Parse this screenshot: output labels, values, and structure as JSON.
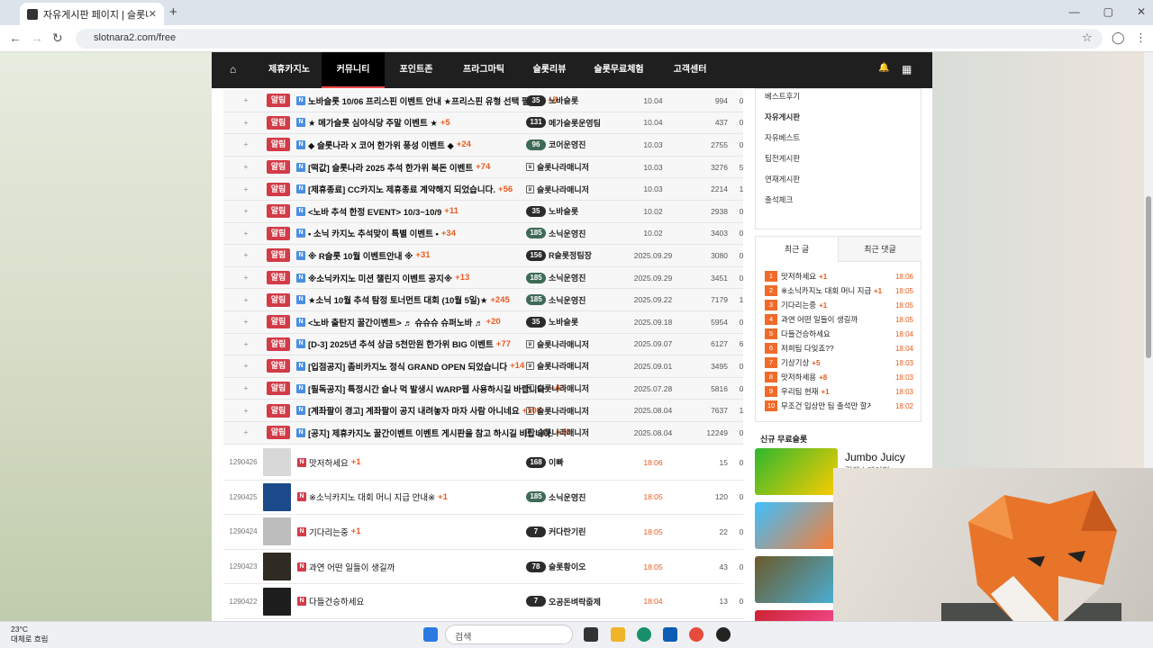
{
  "browser": {
    "tab_title": "자유게시판 페이지 | 슬롯나라",
    "close": "✕",
    "new_tab": "+",
    "url": "slotnara2.com/free",
    "win_min": "—",
    "win_max": "▢",
    "win_close": "✕"
  },
  "nav": {
    "home": "⌂",
    "items": [
      "제휴카지노",
      "커뮤니티",
      "포인트존",
      "프라그마틱",
      "슬롯리뷰",
      "슬롯무료체험",
      "고객센터"
    ],
    "active": "커뮤니티"
  },
  "notice_label": "알림",
  "notices": [
    {
      "title": "노바슬롯 10/06 프리스핀 이벤트 안내 ★프리스핀 유형 선택 필수★",
      "count": "+5",
      "level": "35",
      "author": "노바슬롯",
      "date": "10.04",
      "views": "994",
      "rec": "0"
    },
    {
      "title": "★ 메가슬롯 심야식당 주말 이벤트 ★",
      "count": "+5",
      "level": "131",
      "author": "메가슬롯운영팀",
      "date": "10.04",
      "views": "437",
      "rec": "0"
    },
    {
      "title": "◆ 슬롯나라 X 코어 한가위 풍성 이벤트 ◆",
      "count": "+24",
      "level": "96",
      "author": "코어운영진",
      "date": "10.03",
      "views": "2755",
      "rec": "0"
    },
    {
      "title": "[떡값] 슬롯나라 2025 추석 한가위 복돈 이벤트",
      "count": "+74",
      "level": "",
      "author": "슬롯나라매니저",
      "date": "10.03",
      "views": "3276",
      "rec": "5"
    },
    {
      "title": "[제휴종료] CC카지노 제휴종료 계약해지 되었습니다.",
      "count": "+56",
      "level": "",
      "author": "슬롯나라매니저",
      "date": "10.03",
      "views": "2214",
      "rec": "1"
    },
    {
      "title": "<노바 추석 한정 EVENT> 10/3~10/9",
      "count": "+11",
      "level": "35",
      "author": "노바슬롯",
      "date": "10.02",
      "views": "2938",
      "rec": "0"
    },
    {
      "title": "• 소닉 카지노 추석맞이 특별 이벤트 •",
      "count": "+34",
      "level": "185",
      "author": "소닉운영진",
      "date": "10.02",
      "views": "3403",
      "rec": "0"
    },
    {
      "title": "※ R슬롯 10월 이벤트안내 ※",
      "count": "+31",
      "level": "156",
      "author": "R슬롯정팀장",
      "date": "2025.09.29",
      "views": "3080",
      "rec": "0"
    },
    {
      "title": "※소닉카지노 미션 챌린지 이벤트 공지※",
      "count": "+13",
      "level": "185",
      "author": "소닉운영진",
      "date": "2025.09.29",
      "views": "3451",
      "rec": "0"
    },
    {
      "title": "★소닉 10월 추석 탐정 토너먼트 대회 (10월 5일)★",
      "count": "+245",
      "level": "185",
      "author": "소닉운영진",
      "date": "2025.09.22",
      "views": "7179",
      "rec": "1"
    },
    {
      "title": "<노바 출탄지 꿀간이벤트> ♬ 슈슈슈 슈퍼노바 ♬",
      "count": "+20",
      "level": "35",
      "author": "노바슬롯",
      "date": "2025.09.18",
      "views": "5954",
      "rec": "0"
    },
    {
      "title": "[D-3] 2025년 추석 상금 5천만원 한가위 BIG 이벤트",
      "count": "+77",
      "level": "",
      "author": "슬롯나라매니저",
      "date": "2025.09.07",
      "views": "6127",
      "rec": "6"
    },
    {
      "title": "[입점공지] 좀비카지노 정식 GRAND OPEN 되었습니다",
      "count": "+14",
      "level": "",
      "author": "슬롯나라매니저",
      "date": "2025.09.01",
      "views": "3495",
      "rec": "0"
    },
    {
      "title": "[필독공지] 특정시간 슬나 먹 발생시 WARP웹 사용하시길 바랍니다.",
      "count": "+43",
      "level": "",
      "author": "슬롯나라매니저",
      "date": "2025.07.28",
      "views": "5816",
      "rec": "0"
    },
    {
      "title": "[계좌팔이 경고] 계좌팔이 공지 내려놓자 마자 사람 아니네요",
      "count": "+108",
      "level": "",
      "author": "슬롯나라매니저",
      "date": "2025.08.04",
      "views": "7637",
      "rec": "1"
    },
    {
      "title": "[공지] 제휴카지노 꿀간이벤트 이벤트 게시판을 참고 하시길 바랍니다.",
      "count": "+22",
      "level": "",
      "author": "슬롯나라매니저",
      "date": "2025.08.04",
      "views": "12249",
      "rec": "0"
    }
  ],
  "posts": [
    {
      "num": "1290426",
      "title": "맛저하세요",
      "count": "+1",
      "level": "168",
      "author": "이빠",
      "date": "18:06",
      "views": "15",
      "rec": "0",
      "thumb": "#d8d8d8"
    },
    {
      "num": "1290425",
      "title": "※소닉카지노 대회 머니 지급 안내※",
      "count": "+1",
      "level": "185",
      "author": "소닉운영진",
      "date": "18:05",
      "views": "120",
      "rec": "0",
      "thumb": "#1b4a8a"
    },
    {
      "num": "1290424",
      "title": "기다리는중",
      "count": "+1",
      "level": "7",
      "author": "커다란기린",
      "date": "18:05",
      "views": "22",
      "rec": "0",
      "thumb": "#bdbdbd"
    },
    {
      "num": "1290423",
      "title": "과연 어떤 일들이 생길까",
      "count": "",
      "level": "78",
      "author": "슬롯황이오",
      "date": "18:05",
      "views": "43",
      "rec": "0",
      "thumb": "#2f2a22"
    },
    {
      "num": "1290422",
      "title": "다들건승하세요",
      "count": "",
      "level": "7",
      "author": "오공돈벼락줍제",
      "date": "18:04",
      "views": "13",
      "rec": "0",
      "thumb": "#1d1d1d"
    }
  ],
  "sidebar": {
    "categories": [
      "베스트후기",
      "자유게시판",
      "자유베스트",
      "팁전게시판",
      "연재게시판",
      "출석체크"
    ],
    "active_category": "자유게시판",
    "tab_recent_posts": "최근 글",
    "tab_recent_comments": "최근 댓글",
    "recent": [
      {
        "rank": "1",
        "title": "맛저하세요",
        "count": "+1",
        "time": "18:06"
      },
      {
        "rank": "2",
        "title": "※소닉카지노 대회 머니 지급 안…",
        "count": "+1",
        "time": "18:05"
      },
      {
        "rank": "3",
        "title": "기다리는중",
        "count": "+1",
        "time": "18:05"
      },
      {
        "rank": "4",
        "title": "과연 어떤 일들이 생길까",
        "count": "",
        "time": "18:05"
      },
      {
        "rank": "5",
        "title": "다들건승하세요",
        "count": "",
        "time": "18:04"
      },
      {
        "rank": "6",
        "title": "저희팀 다잊죠??",
        "count": "",
        "time": "18:04"
      },
      {
        "rank": "7",
        "title": "기상기상",
        "count": "+5",
        "time": "18:03"
      },
      {
        "rank": "8",
        "title": "맛저하세용",
        "count": "+8",
        "time": "18:03"
      },
      {
        "rank": "9",
        "title": "우리팀 현재",
        "count": "+1",
        "time": "18:03"
      },
      {
        "rank": "10",
        "title": "무조건 입상만 팀 출석만 할게요",
        "count": "",
        "time": "18:02"
      }
    ],
    "free_slots_title": "신규 무료슬롯",
    "game1_name": "Jumbo Juicy",
    "game1_sub": "릴렉스게이밍"
  },
  "taskbar": {
    "temp": "23°C",
    "weather": "대체로 흐림",
    "search": "검색"
  }
}
